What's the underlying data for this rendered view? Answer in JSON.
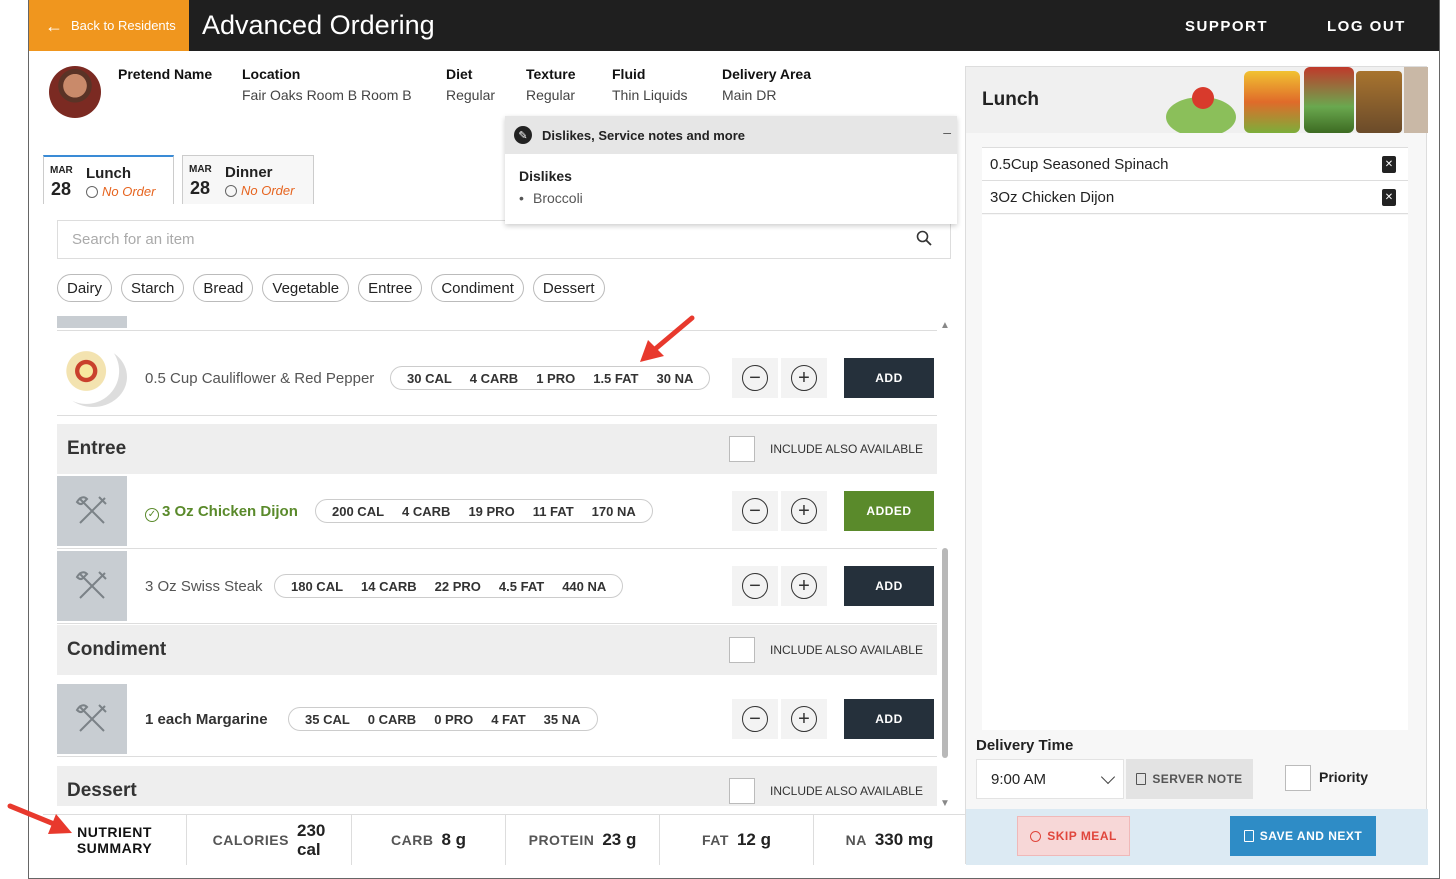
{
  "header": {
    "back_label": "Back to Residents",
    "title": "Advanced Ordering",
    "support": "SUPPORT",
    "logout": "LOG OUT"
  },
  "resident": {
    "name": "Pretend Name",
    "location_label": "Location",
    "location": "Fair Oaks Room B Room B",
    "diet_label": "Diet",
    "diet": "Regular",
    "texture_label": "Texture",
    "texture": "Regular",
    "fluid_label": "Fluid",
    "fluid": "Thin Liquids",
    "delivery_label": "Delivery Area",
    "delivery": "Main DR"
  },
  "dislikes": {
    "header": "Dislikes, Service notes and more",
    "minimize": "–",
    "title": "Dislikes",
    "items": [
      "Broccoli"
    ]
  },
  "meal_tabs": [
    {
      "month": "MAR",
      "day": "28",
      "name": "Lunch",
      "status": "No Order"
    },
    {
      "month": "MAR",
      "day": "28",
      "name": "Dinner",
      "status": "No Order"
    }
  ],
  "search": {
    "placeholder": "Search for an item"
  },
  "categories": [
    "Dairy",
    "Starch",
    "Bread",
    "Vegetable",
    "Entree",
    "Condiment",
    "Dessert"
  ],
  "items": {
    "cauliflower": {
      "name": "0.5 Cup Cauliflower & Red Pepper",
      "cal": "30 CAL",
      "carb": "4 CARB",
      "pro": "1 PRO",
      "fat": "1.5 FAT",
      "na": "30 NA",
      "button": "ADD"
    },
    "chicken": {
      "name": "3 Oz Chicken Dijon",
      "cal": "200 CAL",
      "carb": "4 CARB",
      "pro": "19 PRO",
      "fat": "11 FAT",
      "na": "170 NA",
      "button": "ADDED"
    },
    "steak": {
      "name": "3 Oz Swiss Steak",
      "cal": "180 CAL",
      "carb": "14 CARB",
      "pro": "22 PRO",
      "fat": "4.5 FAT",
      "na": "440 NA",
      "button": "ADD"
    },
    "margarine": {
      "name": "1 each Margarine",
      "cal": "35 CAL",
      "carb": "0 CARB",
      "pro": "0 PRO",
      "fat": "4 FAT",
      "na": "35 NA",
      "button": "ADD"
    }
  },
  "sections": {
    "entree": "Entree",
    "condiment": "Condiment",
    "dessert": "Dessert",
    "include_label": "INCLUDE ALSO AVAILABLE"
  },
  "nutrient_summary": {
    "label_line1": "NUTRIENT",
    "label_line2": "SUMMARY",
    "calories_label": "CALORIES",
    "calories_value": "230",
    "calories_unit": "cal",
    "carb_label": "CARB",
    "carb_value": "8 g",
    "protein_label": "PROTEIN",
    "protein_value": "23 g",
    "fat_label": "FAT",
    "fat_value": "12 g",
    "na_label": "NA",
    "na_value": "330 mg"
  },
  "order": {
    "meal_title": "Lunch",
    "items": [
      "0.5Cup Seasoned Spinach",
      "3Oz Chicken Dijon"
    ],
    "delivery_label": "Delivery Time",
    "delivery_time": "9:00 AM",
    "server_note": "SERVER NOTE",
    "priority": "Priority",
    "skip": "SKIP MEAL",
    "save": "SAVE AND NEXT"
  },
  "colors": {
    "accent_orange": "#f0961e",
    "header_dark": "#1f1f1f",
    "added_green": "#5a8a2b",
    "add_dark": "#25303b",
    "save_blue": "#2e8cc6",
    "skip_red": "#e0463c"
  }
}
